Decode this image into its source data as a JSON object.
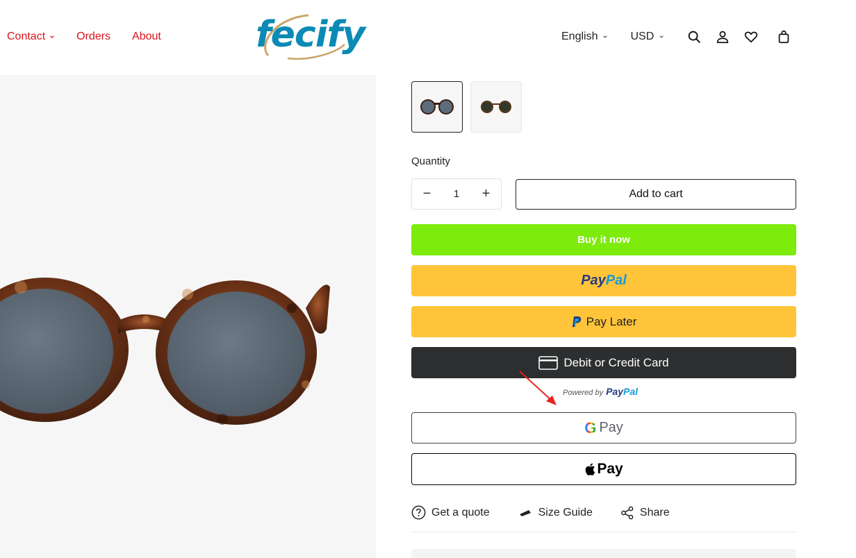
{
  "nav": {
    "items": [
      {
        "label": "Contact",
        "has_dropdown": true
      },
      {
        "label": "Orders",
        "has_dropdown": false
      },
      {
        "label": "About",
        "has_dropdown": false
      }
    ]
  },
  "logo": {
    "text": "fecify"
  },
  "header": {
    "language": "English",
    "currency": "USD",
    "icons": [
      "search-icon",
      "account-icon",
      "wishlist-icon",
      "cart-icon"
    ]
  },
  "product": {
    "thumbnails": [
      "tortoise-sunglasses-blue-lens",
      "tortoise-sunglasses-green-lens"
    ],
    "quantity_label": "Quantity",
    "quantity": "1",
    "decrease_symbol": "−",
    "increase_symbol": "+",
    "add_to_cart": "Add to cart",
    "buy_now": "Buy it now",
    "paypal_a": "Pay",
    "paypal_b": "Pal",
    "pay_later": "Pay Later",
    "card": "Debit or Credit Card",
    "powered_by": "Powered by",
    "gpay_g": "G",
    "gpay_label": "Pay",
    "applepay_label": "Pay"
  },
  "links": {
    "quote": "Get a quote",
    "size_guide": "Size Guide",
    "share": "Share"
  },
  "colors": {
    "nav_red": "#d7141a",
    "buy_now_green": "#7deb0c",
    "paypal_yellow": "#ffc439",
    "card_dark": "#2c2e2f",
    "logo_blue": "#0b8ab5"
  }
}
